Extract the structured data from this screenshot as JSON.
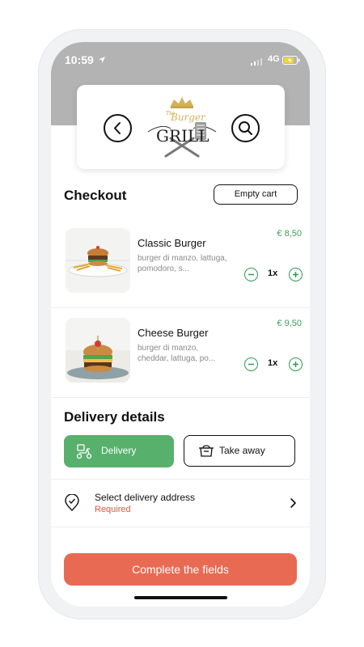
{
  "status_bar": {
    "time": "10:59",
    "network": "4G"
  },
  "header": {
    "logo_the": "The",
    "logo_burger": "Burger",
    "logo_grill": "GRILL"
  },
  "checkout": {
    "title": "Checkout",
    "empty_cart_label": "Empty cart"
  },
  "cart_items": [
    {
      "name": "Classic Burger",
      "description": "burger di manzo, lattuga, pomodoro, s...",
      "price": "€ 8,50",
      "qty": "1x"
    },
    {
      "name": "Cheese Burger",
      "description": "burger di manzo, cheddar, lattuga, po...",
      "price": "€ 9,50",
      "qty": "1x"
    }
  ],
  "delivery_details": {
    "title": "Delivery details",
    "delivery_label": "Delivery",
    "takeaway_label": "Take away",
    "address_title": "Select delivery address",
    "address_status": "Required"
  },
  "footer": {
    "complete_label": "Complete the fields"
  },
  "colors": {
    "green": "#58b06d",
    "red": "#e86a52",
    "header_grey": "#b3b3b3",
    "price_green": "#3f9d58",
    "required_red": "#e2553f"
  }
}
